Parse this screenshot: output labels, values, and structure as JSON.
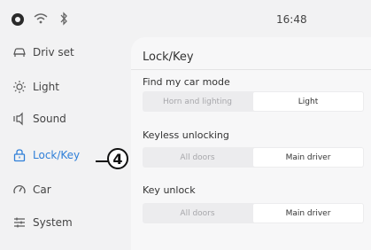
{
  "status_bar": {
    "time": "16:48"
  },
  "sidebar": {
    "items": [
      {
        "label": "Driv set",
        "icon": "car-seat-icon"
      },
      {
        "label": "Light",
        "icon": "sun-icon"
      },
      {
        "label": "Sound",
        "icon": "speaker-icon"
      },
      {
        "label": "Lock/Key",
        "icon": "lock-icon",
        "active": true
      },
      {
        "label": "Car",
        "icon": "gauge-icon"
      },
      {
        "label": "System",
        "icon": "sliders-icon"
      }
    ]
  },
  "callout": {
    "number": "4"
  },
  "panel": {
    "title": "Lock/Key",
    "sections": [
      {
        "label": "Find my car mode",
        "options": [
          "Horn and lighting",
          "Light"
        ],
        "selected": "Light"
      },
      {
        "label": "Keyless unlocking",
        "options": [
          "All doors",
          "Main driver"
        ],
        "selected": "Main driver"
      },
      {
        "label": "Key unlock",
        "options": [
          "All doors",
          "Main driver"
        ],
        "selected": "Main driver"
      }
    ]
  },
  "colors": {
    "accent": "#2f7fd8",
    "background": "#f2f2f3",
    "panel": "#f7f7f8"
  }
}
